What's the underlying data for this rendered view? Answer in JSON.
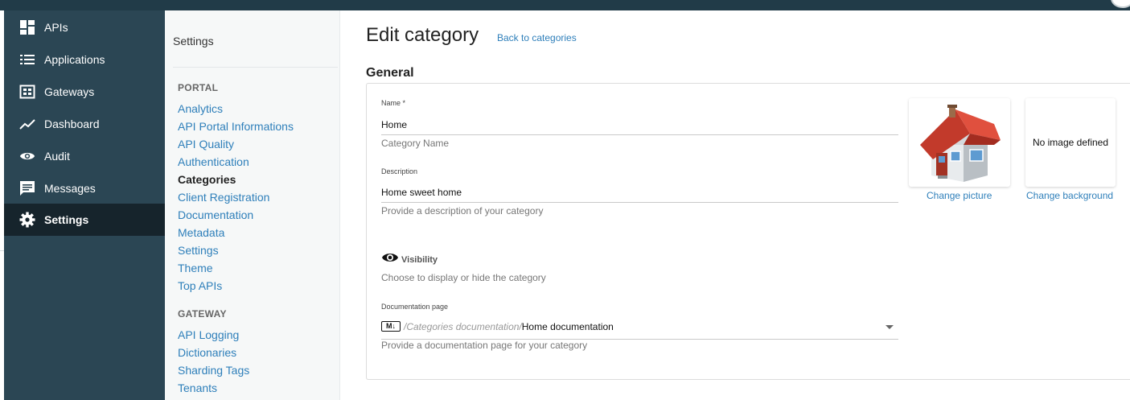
{
  "nav": {
    "items": [
      {
        "label": "APIs",
        "icon": "dashboard-grid-icon"
      },
      {
        "label": "Applications",
        "icon": "list-icon"
      },
      {
        "label": "Gateways",
        "icon": "gateway-icon"
      },
      {
        "label": "Dashboard",
        "icon": "trending-icon"
      },
      {
        "label": "Audit",
        "icon": "eye-icon"
      },
      {
        "label": "Messages",
        "icon": "message-icon"
      },
      {
        "label": "Settings",
        "icon": "gear-icon",
        "active": true
      }
    ]
  },
  "settings_panel": {
    "title": "Settings",
    "groups": [
      {
        "title": "PORTAL",
        "links": [
          "Analytics",
          "API Portal Informations",
          "API Quality",
          "Authentication",
          "Categories",
          "Client Registration",
          "Documentation",
          "Metadata",
          "Settings",
          "Theme",
          "Top APIs"
        ]
      },
      {
        "title": "GATEWAY",
        "links": [
          "API Logging",
          "Dictionaries",
          "Sharding Tags",
          "Tenants"
        ]
      }
    ],
    "active_link": "Categories"
  },
  "page": {
    "title": "Edit category",
    "back_link": "Back to categories",
    "section_title": "General"
  },
  "form": {
    "name": {
      "label": "Name *",
      "value": "Home",
      "hint": "Category Name"
    },
    "description": {
      "label": "Description",
      "value": "Home sweet home",
      "hint": "Provide a description of your category"
    },
    "visibility": {
      "label": "Visibility",
      "hint": "Choose to display or hide the category"
    },
    "documentation_page": {
      "label": "Documentation page",
      "badge": "M↓",
      "path_prefix": "/Categories documentation/",
      "value": "Home documentation",
      "hint": "Provide a documentation page for your category"
    }
  },
  "images": {
    "picture": {
      "link": "Change picture",
      "icon": "house-icon"
    },
    "background": {
      "empty_text": "No image defined",
      "link": "Change background"
    }
  },
  "colors": {
    "sidebar": "#2b4654",
    "sidebar_active": "#16242c",
    "topbar": "#213b48",
    "link": "#2e7fba"
  }
}
